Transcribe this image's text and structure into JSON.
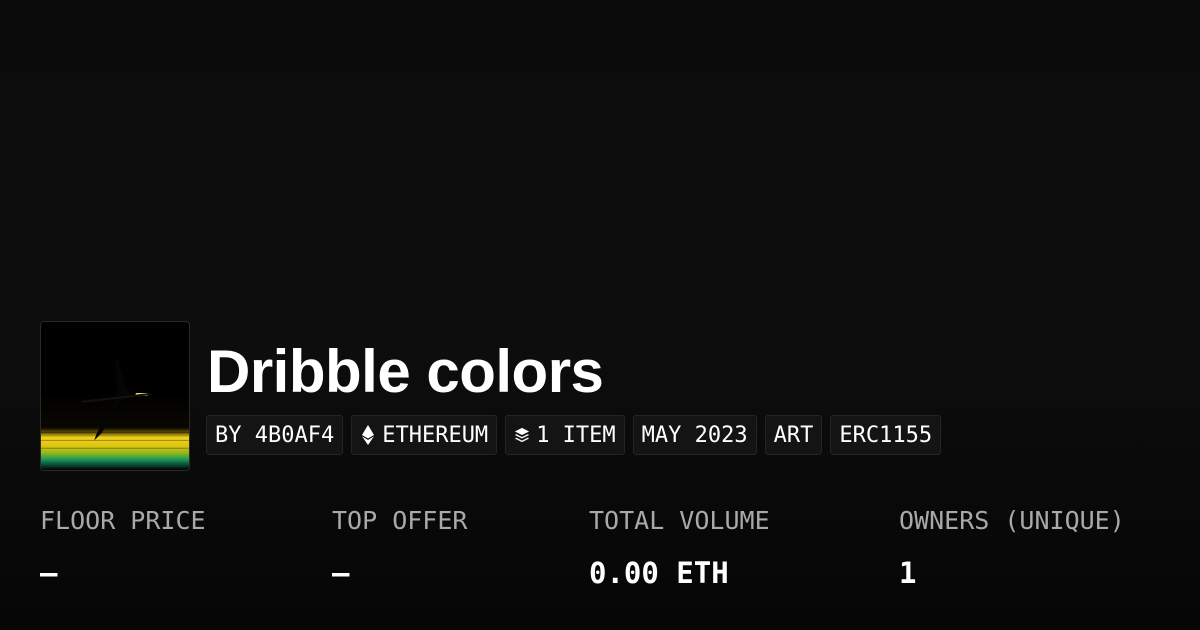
{
  "collection": {
    "title": "Dribble colors",
    "image_alt": "collection-artwork"
  },
  "tags": [
    {
      "label": "BY 4B0AF4",
      "icon": ""
    },
    {
      "label": "ETHEREUM",
      "icon": "ethereum-icon"
    },
    {
      "label": "1 ITEM",
      "icon": "layers-icon"
    },
    {
      "label": "MAY 2023",
      "icon": ""
    },
    {
      "label": "ART",
      "icon": ""
    },
    {
      "label": "ERC1155",
      "icon": ""
    }
  ],
  "stats": [
    {
      "label": "FLOOR PRICE",
      "value": "–"
    },
    {
      "label": "TOP OFFER",
      "value": "–"
    },
    {
      "label": "TOTAL VOLUME",
      "value": "0.00 ETH"
    },
    {
      "label": "OWNERS (UNIQUE)",
      "value": "1"
    }
  ],
  "colors": {
    "background": "#0c0c0c",
    "tag_background": "#141414",
    "label_gray": "#a9a9a9",
    "artwork_yellow": "#f2d21a",
    "artwork_green": "#1d9a58"
  }
}
